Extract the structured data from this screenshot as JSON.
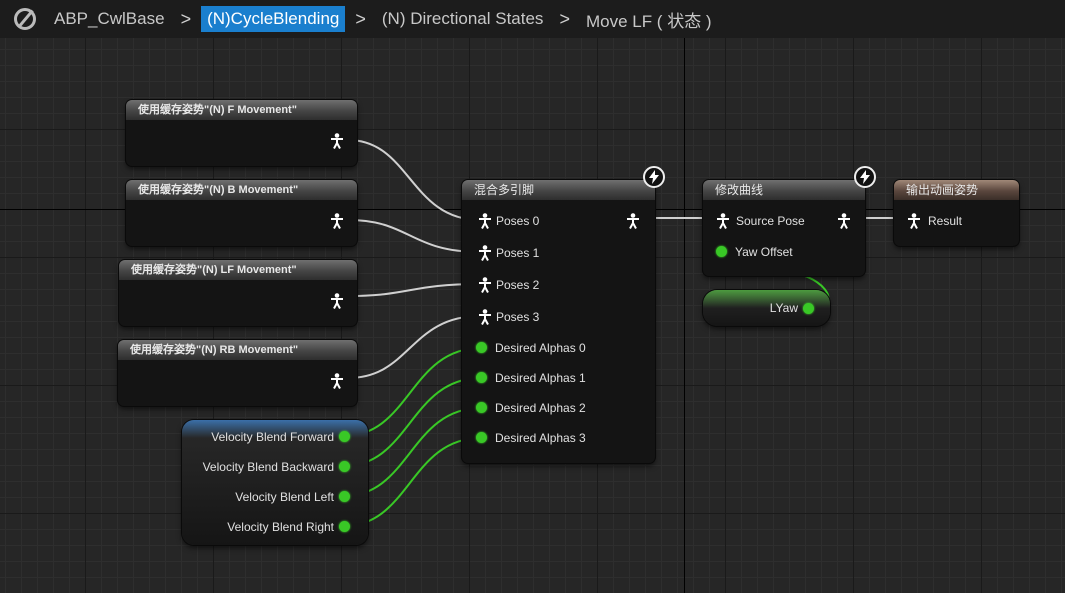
{
  "breadcrumb": {
    "items": [
      "ABP_CwlBase",
      "(N)CycleBlending",
      "(N) Directional States",
      "Move LF ( 状态 )"
    ],
    "separator": ">"
  },
  "nodes": {
    "cache_f": {
      "title": "使用缓存姿势\"(N) F Movement\""
    },
    "cache_b": {
      "title": "使用缓存姿势\"(N) B Movement\""
    },
    "cache_lf": {
      "title": "使用缓存姿势\"(N) LF Movement\""
    },
    "cache_rb": {
      "title": "使用缓存姿势\"(N) RB Movement\""
    },
    "velocity": {
      "outputs": [
        "Velocity Blend Forward",
        "Velocity Blend Backward",
        "Velocity Blend Left",
        "Velocity Blend Right"
      ]
    },
    "blend": {
      "title": "混合多引脚",
      "pose_inputs": [
        "Poses 0",
        "Poses 1",
        "Poses 2",
        "Poses 3"
      ],
      "alpha_inputs": [
        "Desired Alphas 0",
        "Desired Alphas 1",
        "Desired Alphas 2",
        "Desired Alphas 3"
      ]
    },
    "modify_curve": {
      "title": "修改曲线",
      "source_pose": "Source Pose",
      "yaw_offset": "Yaw Offset"
    },
    "lyaw": {
      "label": "LYaw"
    },
    "output": {
      "title": "输出动画姿势",
      "result": "Result"
    }
  },
  "colors": {
    "accent": "#1a7fce",
    "pose_wire": "#cfcfcf",
    "float_pin": "#39c826",
    "output_header": "#5a463d"
  },
  "icons": [
    "pose-pin-icon",
    "float-pin-icon",
    "fast-path-bolt-icon",
    "unreal-logo-icon"
  ]
}
